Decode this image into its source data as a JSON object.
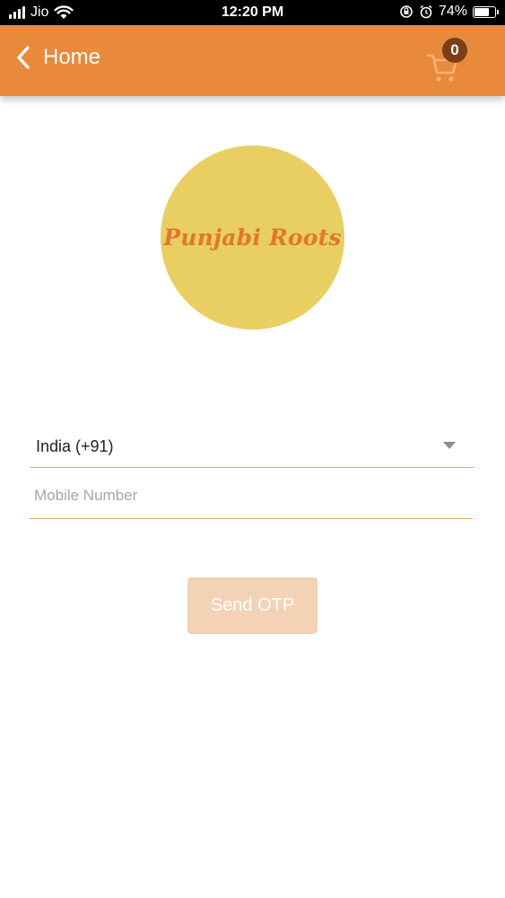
{
  "status_bar": {
    "carrier": "Jio",
    "time": "12:20 PM",
    "battery_percent": "74%",
    "battery_level": 0.74,
    "icons": [
      "signal-icon",
      "wifi-icon",
      "orientation-lock-icon",
      "alarm-icon",
      "battery-icon"
    ]
  },
  "header": {
    "back_label": "Home",
    "cart_count": "0",
    "background_color": "#E8893C",
    "icons": [
      "chevron-left-icon",
      "cart-icon"
    ]
  },
  "logo": {
    "text": "Punjabi Roots",
    "circle_color": "#E9CE62",
    "text_color": "#E0782B"
  },
  "form": {
    "country_value": "India (+91)",
    "mobile_placeholder": "Mobile Number",
    "mobile_value": "",
    "send_otp_label": "Send OTP",
    "button_color": "#F3D2B6",
    "underline_color": "#E0A468",
    "icons": [
      "dropdown-arrow-icon"
    ]
  }
}
